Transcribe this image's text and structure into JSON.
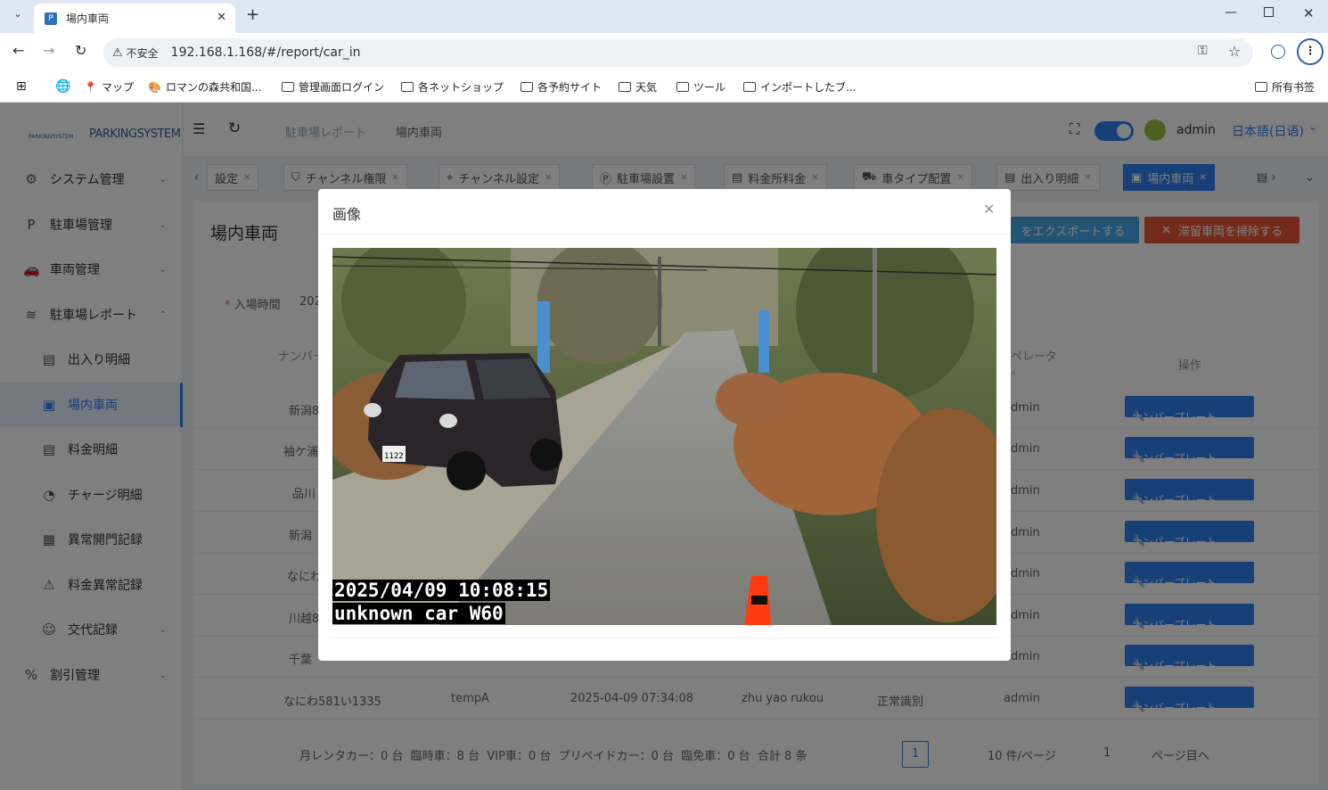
{
  "browser": {
    "tab_title": "場内車両",
    "security_label": "不安全",
    "url": "192.168.1.168/#/report/car_in",
    "bookmarks": [
      "マップ",
      "ロマンの森共和国...",
      "管理画面ログイン",
      "各ネットショップ",
      "各予約サイト",
      "天気",
      "ツール",
      "インポートしたブ...",
      "所有书签"
    ]
  },
  "app": {
    "logo_text": "PARKINGSYSTEM",
    "logo_sub": "PARKINGSYSTEM",
    "breadcrumb": [
      "駐車場レポート",
      "場内車両"
    ],
    "user": "admin",
    "language": "日本語(日语)",
    "sidebar": [
      {
        "label": "システム管理",
        "icon": "gear-icon"
      },
      {
        "label": "駐車場管理",
        "icon": "parking-icon"
      },
      {
        "label": "車両管理",
        "icon": "car-icon"
      },
      {
        "label": "駐車場レポート",
        "icon": "layers-icon"
      },
      {
        "label": "出入り明細",
        "icon": "doc-icon"
      },
      {
        "label": "場内車両",
        "icon": "car-doc-icon"
      },
      {
        "label": "料金明細",
        "icon": "list-icon"
      },
      {
        "label": "チャージ明細",
        "icon": "charge-icon"
      },
      {
        "label": "異常開門記録",
        "icon": "gate-icon"
      },
      {
        "label": "料金異常記録",
        "icon": "warning-icon"
      },
      {
        "label": "交代記録",
        "icon": "user-icon"
      },
      {
        "label": "割引管理",
        "icon": "discount-icon"
      }
    ],
    "tags": [
      "設定",
      "チャンネル権限",
      "チャンネル設定",
      "駐車場設置",
      "料金所料金",
      "車タイプ配置",
      "出入り明細",
      "場内車両"
    ],
    "page_title": "場内車両",
    "export_button": "をエクスポートする",
    "clear_button": "滞留車両を掃除する",
    "filter_label": "入場時間",
    "filter_value": "202",
    "col_plate": "ナンバー",
    "col_operator": "ペレータ",
    "col_action": "操作",
    "rows": [
      {
        "plate": "新潟8",
        "operator": "dmin"
      },
      {
        "plate": "袖ケ浦",
        "operator": "dmin"
      },
      {
        "plate": "品川",
        "operator": "dmin"
      },
      {
        "plate": "新潟",
        "operator": "dmin"
      },
      {
        "plate": "なにわ",
        "operator": "dmin"
      },
      {
        "plate": "川越8",
        "operator": "dmin"
      },
      {
        "plate": "千葉",
        "operator": "dmin"
      },
      {
        "plate": "なにわ581い1335",
        "type": "tempA",
        "time": "2025-04-09 07:34:08",
        "gate": "zhu yao rukou",
        "status": "正常識別",
        "operator": "admin"
      }
    ],
    "plate_button": "ナンバープレート",
    "footer": "月レンタカー：0 台  臨時車：8 台  VIP車：0 台  プリペイドカー：0 台  臨免車：0 台  合計 8 条",
    "page_num": "1",
    "page_size": "10 件/ページ",
    "goto_value": "1",
    "goto_label": "ページ目へ"
  },
  "dialog": {
    "title": "画像",
    "osd_time": "2025/04/09 10:08:15",
    "osd_text": "unknown car W60",
    "license_plate": "1122"
  }
}
